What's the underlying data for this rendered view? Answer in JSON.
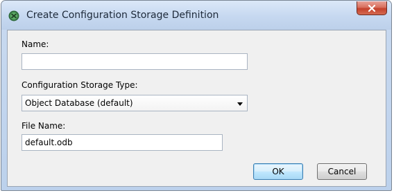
{
  "window": {
    "title": "Create Configuration Storage Definition"
  },
  "icons": {
    "app": "app-icon",
    "close": "close-icon",
    "dropdown": "chevron-down-icon"
  },
  "colors": {
    "title_bar": "#c6d8f0",
    "close_button": "#c4412c",
    "default_button_border": "#3c7fb1"
  },
  "form": {
    "name_label": "Name:",
    "name_value": "",
    "storage_type_label": "Configuration Storage Type:",
    "storage_type_selected": "Object Database (default)",
    "file_name_label": "File Name:",
    "file_name_value": "default.odb"
  },
  "buttons": {
    "ok": "OK",
    "cancel": "Cancel"
  }
}
